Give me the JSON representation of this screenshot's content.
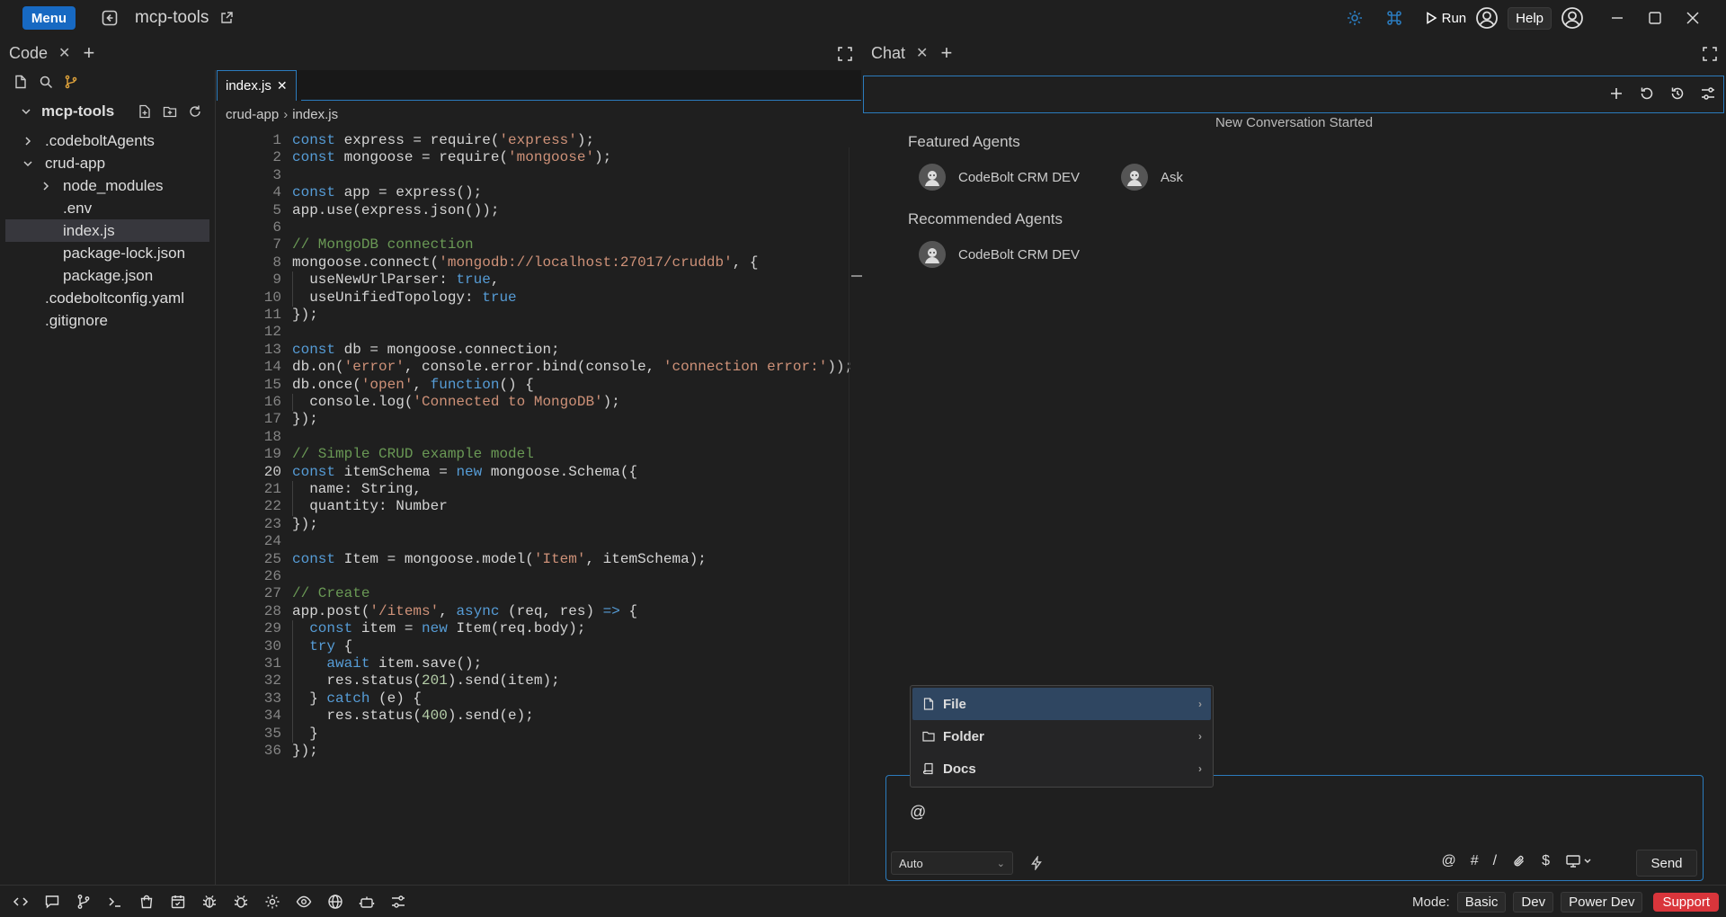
{
  "titlebar": {
    "menu_label": "Menu",
    "project_name": "mcp-tools",
    "run_label": "Run",
    "help_label": "Help"
  },
  "left_panel": {
    "tab_label": "Code",
    "explorer": {
      "root": "mcp-tools",
      "items": [
        {
          "label": ".codeboltAgents",
          "type": "folder",
          "expanded": false
        },
        {
          "label": "crud-app",
          "type": "folder",
          "expanded": true
        },
        {
          "label": "node_modules",
          "type": "folder",
          "expanded": false
        },
        {
          "label": ".env",
          "type": "file"
        },
        {
          "label": "index.js",
          "type": "file",
          "selected": true
        },
        {
          "label": "package-lock.json",
          "type": "file"
        },
        {
          "label": "package.json",
          "type": "file"
        },
        {
          "label": ".codeboltconfig.yaml",
          "type": "file"
        },
        {
          "label": ".gitignore",
          "type": "file"
        }
      ]
    },
    "editor": {
      "tab_label": "index.js",
      "breadcrumb": [
        "crud-app",
        "index.js"
      ],
      "current_line": 20,
      "lines": [
        "const express = require('express');",
        "const mongoose = require('mongoose');",
        "",
        "const app = express();",
        "app.use(express.json());",
        "",
        "// MongoDB connection",
        "mongoose.connect('mongodb://localhost:27017/cruddb', {",
        "  useNewUrlParser: true,",
        "  useUnifiedTopology: true",
        "});",
        "",
        "const db = mongoose.connection;",
        "db.on('error', console.error.bind(console, 'connection error:'));",
        "db.once('open', function() {",
        "  console.log('Connected to MongoDB');",
        "});",
        "",
        "// Simple CRUD example model",
        "const itemSchema = new mongoose.Schema({",
        "  name: String,",
        "  quantity: Number",
        "});",
        "",
        "const Item = mongoose.model('Item', itemSchema);",
        "",
        "// Create",
        "app.post('/items', async (req, res) => {",
        "  const item = new Item(req.body);",
        "  try {",
        "    await item.save();",
        "    res.status(201).send(item);",
        "  } catch (e) {",
        "    res.status(400).send(e);",
        "  }",
        "});"
      ]
    }
  },
  "chat_panel": {
    "tab_label": "Chat",
    "conversation_status": "New Conversation Started",
    "featured_title": "Featured Agents",
    "featured_agents": [
      "CodeBolt CRM DEV",
      "Ask"
    ],
    "recommended_title": "Recommended Agents",
    "recommended_agents": [
      "CodeBolt CRM DEV"
    ],
    "context_menu": [
      {
        "label": "File",
        "icon": "file-icon",
        "highlighted": true
      },
      {
        "label": "Folder",
        "icon": "folder-icon"
      },
      {
        "label": "Docs",
        "icon": "book-icon"
      }
    ],
    "input_value": "@",
    "model_select": "Auto",
    "input_tools": [
      "@",
      "#",
      "/",
      "$"
    ],
    "send_label": "Send"
  },
  "statusbar": {
    "mode_label": "Mode:",
    "modes": [
      "Basic",
      "Dev",
      "Power Dev"
    ],
    "support_label": "Support"
  },
  "colors": {
    "accent": "#2b7bbd",
    "menu_button": "#1769c2",
    "support": "#d9353b",
    "keyword": "#569cd6",
    "string": "#ce9178",
    "comment": "#6a9955",
    "number": "#b5cea8"
  }
}
